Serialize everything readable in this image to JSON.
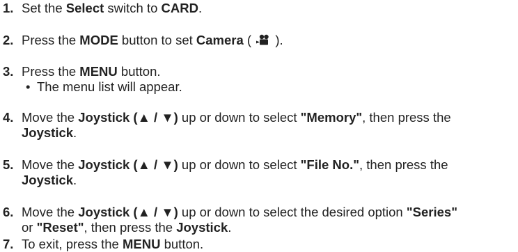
{
  "steps": [
    {
      "num": "1.",
      "parts": [
        "Set the ",
        "Select",
        " switch to ",
        "CARD",
        "."
      ]
    },
    {
      "num": "2.",
      "parts": [
        "Press the ",
        "MODE",
        " button to set ",
        "Camera",
        " ( ",
        " )."
      ],
      "icon": "movie-camera-icon"
    },
    {
      "num": "3.",
      "parts": [
        "Press the ",
        "MENU",
        " button."
      ],
      "bullet": "•",
      "sub": "The menu list will appear."
    },
    {
      "num": "4.",
      "line1": [
        "Move the ",
        "Joystick (▲ / ▼)",
        " up or down to select ",
        "\"Memory\"",
        ", then press the"
      ],
      "line2": [
        "Joystick",
        "."
      ]
    },
    {
      "num": "5.",
      "line1": [
        "Move the ",
        "Joystick (▲ / ▼)",
        " up or down to select ",
        "\"File No.\"",
        ", then press the"
      ],
      "line2": [
        "Joystick",
        "."
      ]
    },
    {
      "num": "6.",
      "line1": [
        "Move the ",
        "Joystick (▲ / ▼)",
        " up or down to select the desired option ",
        "\"Series\""
      ],
      "line2": [
        "or ",
        "\"Reset\"",
        ", then press the ",
        "Joystick",
        "."
      ]
    },
    {
      "num": "7.",
      "parts": [
        "To exit, press the ",
        "MENU",
        " button."
      ]
    }
  ]
}
